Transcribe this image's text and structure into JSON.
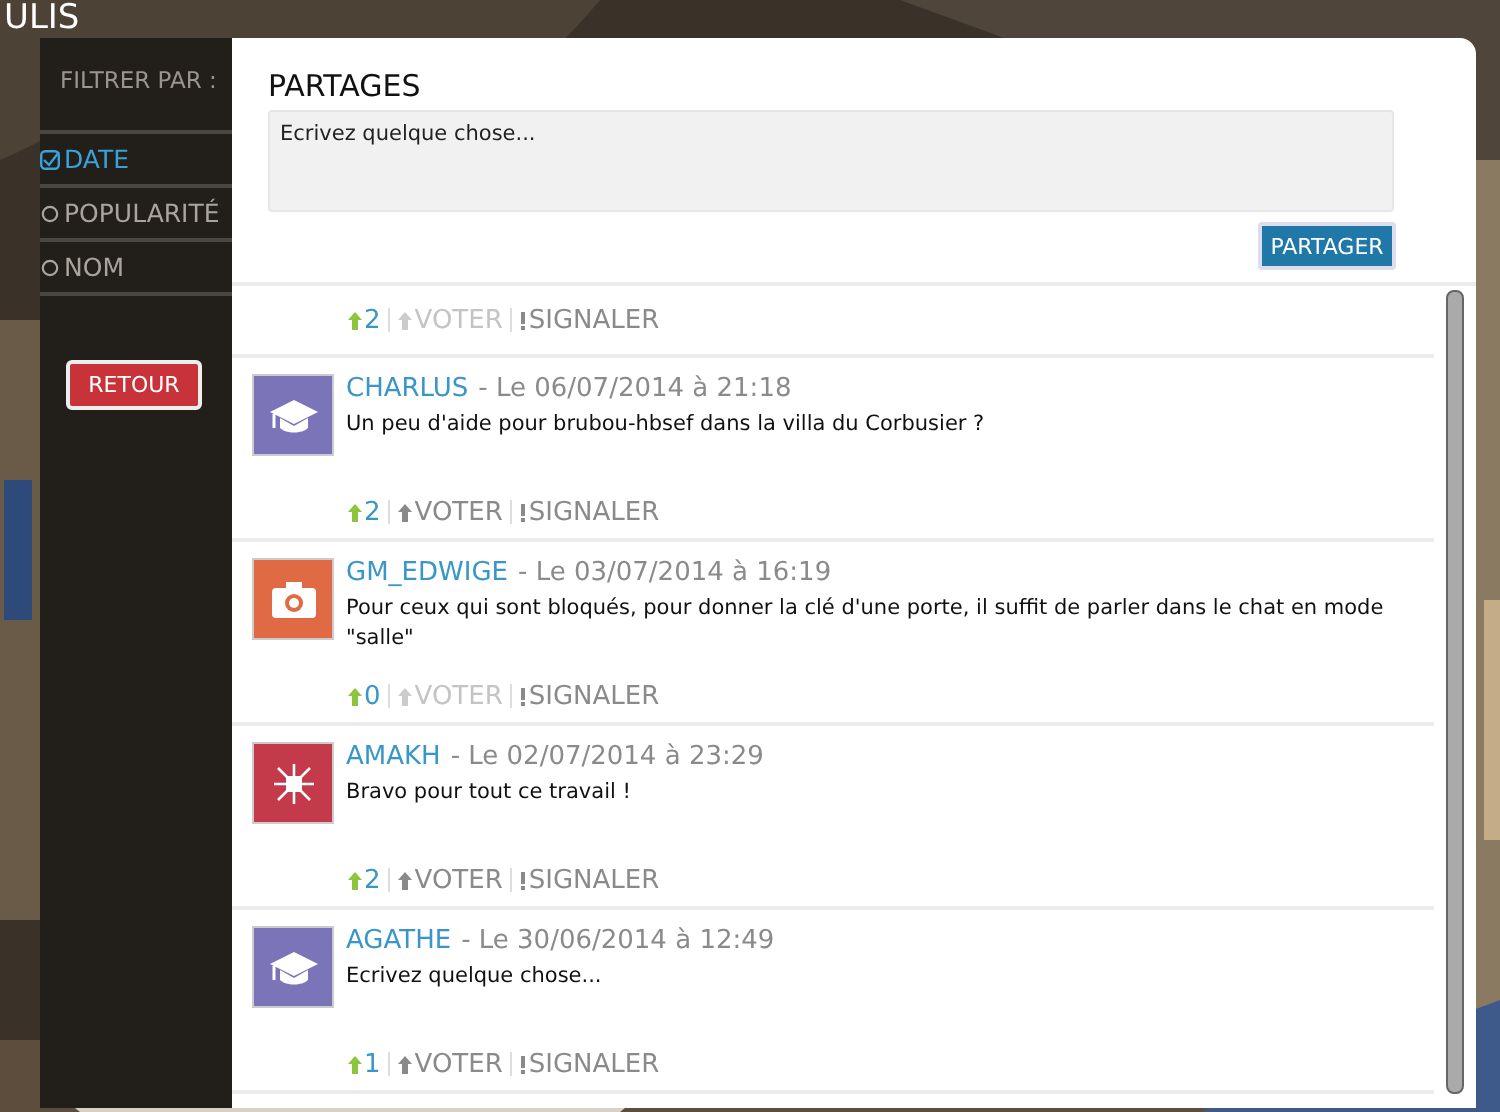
{
  "title": "ULIS",
  "filter": {
    "label": "FILTRER PAR :",
    "options": [
      {
        "label": "DATE",
        "selected": true
      },
      {
        "label": "POPULARITÉ",
        "selected": false
      },
      {
        "label": "NOM",
        "selected": false
      }
    ],
    "back": "RETOUR"
  },
  "panel": {
    "heading": "PARTAGES",
    "placeholder": "Ecrivez quelque chose...",
    "submit": "PARTAGER"
  },
  "posts": [
    {
      "kind": "tail",
      "votes": "2",
      "vote": "VOTER",
      "vote_disabled": true,
      "report": "SIGNALER"
    },
    {
      "kind": "full",
      "avatar": {
        "kind": "cap",
        "color": "#7b74b9"
      },
      "author": "CHARLUS",
      "date": "- Le 06/07/2014 à 21:18",
      "text": "Un peu d'aide pour brubou-hbsef dans la villa du Corbusier ?",
      "votes": "2",
      "vote": "VOTER",
      "vote_disabled": false,
      "report": "SIGNALER"
    },
    {
      "kind": "full",
      "avatar": {
        "kind": "camera",
        "color": "#e06a43"
      },
      "author": "GM_EDWIGE",
      "date": "- Le 03/07/2014 à 16:19",
      "text": "Pour ceux qui sont bloqués, pour donner la clé d'une porte, il suffit de parler dans le chat en mode \"salle\"",
      "votes": "0",
      "vote": "VOTER",
      "vote_disabled": true,
      "report": "SIGNALER"
    },
    {
      "kind": "full",
      "avatar": {
        "kind": "circuit",
        "color": "#c43a4b"
      },
      "author": "AMAKH",
      "date": "- Le 02/07/2014 à 23:29",
      "text": "Bravo pour tout ce travail !",
      "votes": "2",
      "vote": "VOTER",
      "vote_disabled": false,
      "report": "SIGNALER"
    },
    {
      "kind": "full",
      "avatar": {
        "kind": "cap",
        "color": "#7b74b9"
      },
      "author": "AGATHE",
      "date": "- Le 30/06/2014 à 12:49",
      "text": "Ecrivez quelque chose...",
      "votes": "1",
      "vote": "VOTER",
      "vote_disabled": false,
      "report": "SIGNALER"
    }
  ]
}
